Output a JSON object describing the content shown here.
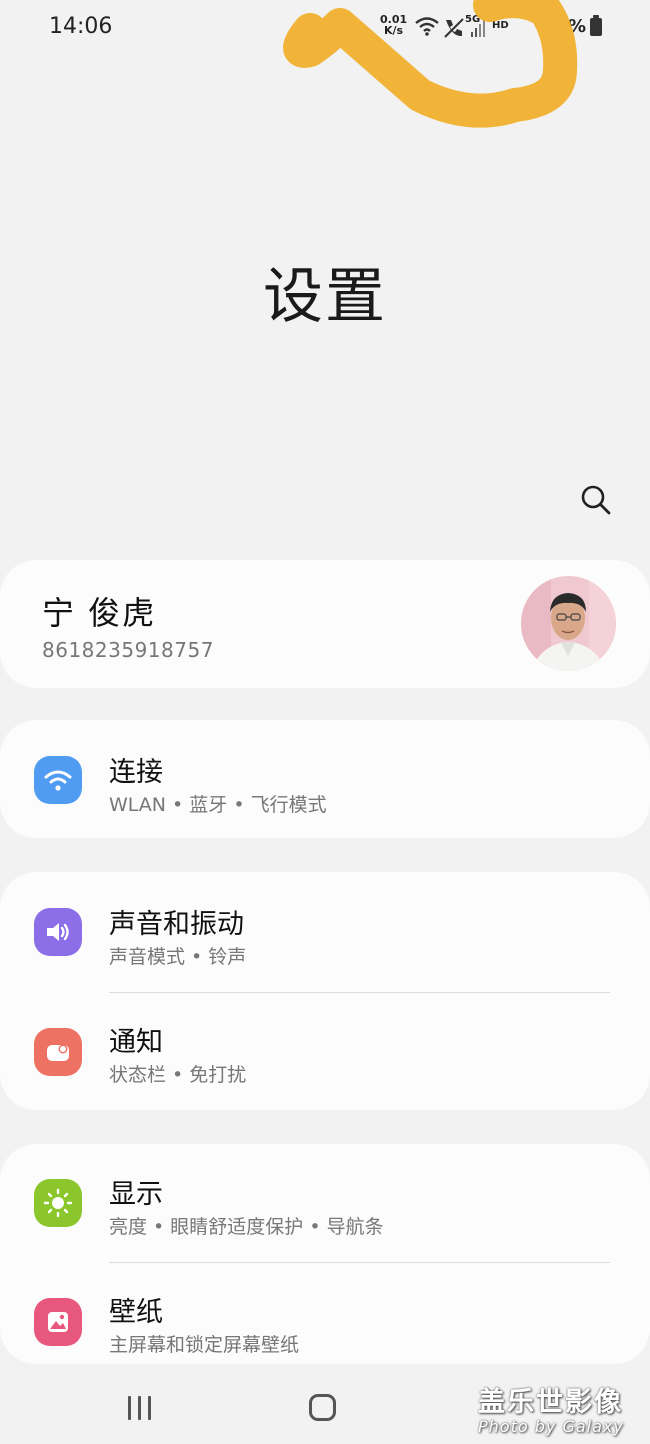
{
  "status_bar": {
    "time": "14:06",
    "net_speed_value": "0.01",
    "net_speed_unit": "K/s",
    "network_type": "5G",
    "hd": "HD",
    "battery_text": "%"
  },
  "page": {
    "title": "设置"
  },
  "search": {
    "icon": "search-icon"
  },
  "profile": {
    "name": "宁 俊虎",
    "phone": "8618235918757"
  },
  "settings": {
    "connections": {
      "title": "连接",
      "subtitle": "WLAN • 蓝牙 • 飞行模式",
      "icon": "wifi-icon",
      "color": "#4f9cf2"
    },
    "sound": {
      "title": "声音和振动",
      "subtitle": "声音模式 • 铃声",
      "icon": "volume-icon",
      "color": "#8b6ee8"
    },
    "notifications": {
      "title": "通知",
      "subtitle": "状态栏 • 免打扰",
      "icon": "notification-icon",
      "color": "#ee7264"
    },
    "display": {
      "title": "显示",
      "subtitle": "亮度 • 眼睛舒适度保护 • 导航条",
      "icon": "sun-icon",
      "color": "#8bc72c"
    },
    "wallpaper": {
      "title": "壁纸",
      "subtitle": "主屏幕和锁定屏幕壁纸",
      "icon": "image-icon",
      "color": "#e8587e"
    }
  },
  "watermark": {
    "title": "盖乐世影像",
    "subtitle": "Photo by Galaxy"
  },
  "colors": {
    "background": "#f2f2f2",
    "card": "#fcfcfc",
    "scribble": "#f0b02e"
  }
}
